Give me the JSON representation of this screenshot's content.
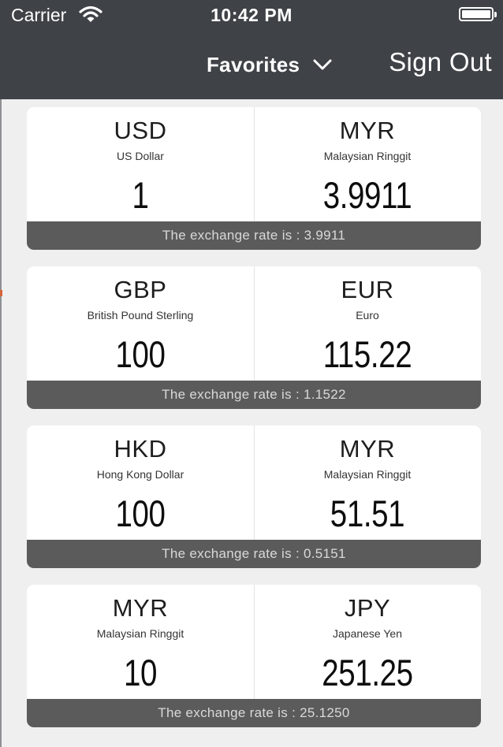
{
  "status_bar": {
    "carrier": "Carrier",
    "time": "10:42 PM"
  },
  "nav": {
    "favorites_label": "Favorites",
    "sign_out_label": "Sign Out"
  },
  "cards": [
    {
      "from": {
        "code": "USD",
        "name": "US Dollar",
        "amount": "1"
      },
      "to": {
        "code": "MYR",
        "name": "Malaysian Ringgit",
        "amount": "3.9911"
      },
      "rate_text": "The exchange rate is : 3.9911"
    },
    {
      "from": {
        "code": "GBP",
        "name": "British Pound Sterling",
        "amount": "100"
      },
      "to": {
        "code": "EUR",
        "name": "Euro",
        "amount": "115.22"
      },
      "rate_text": "The exchange rate is : 1.1522"
    },
    {
      "from": {
        "code": "HKD",
        "name": "Hong Kong Dollar",
        "amount": "100"
      },
      "to": {
        "code": "MYR",
        "name": "Malaysian Ringgit",
        "amount": "51.51"
      },
      "rate_text": "The exchange rate is : 0.5151"
    },
    {
      "from": {
        "code": "MYR",
        "name": "Malaysian Ringgit",
        "amount": "10"
      },
      "to": {
        "code": "JPY",
        "name": "Japanese Yen",
        "amount": "251.25"
      },
      "rate_text": "The exchange rate is : 25.1250"
    }
  ],
  "colors": {
    "header_bg": "#3f4247",
    "page_bg": "#efefef",
    "rate_bar_bg": "#5b5b5b"
  },
  "icons": {
    "wifi": "wifi-icon",
    "battery": "battery-icon",
    "dropdown": "chevron-down-icon"
  }
}
